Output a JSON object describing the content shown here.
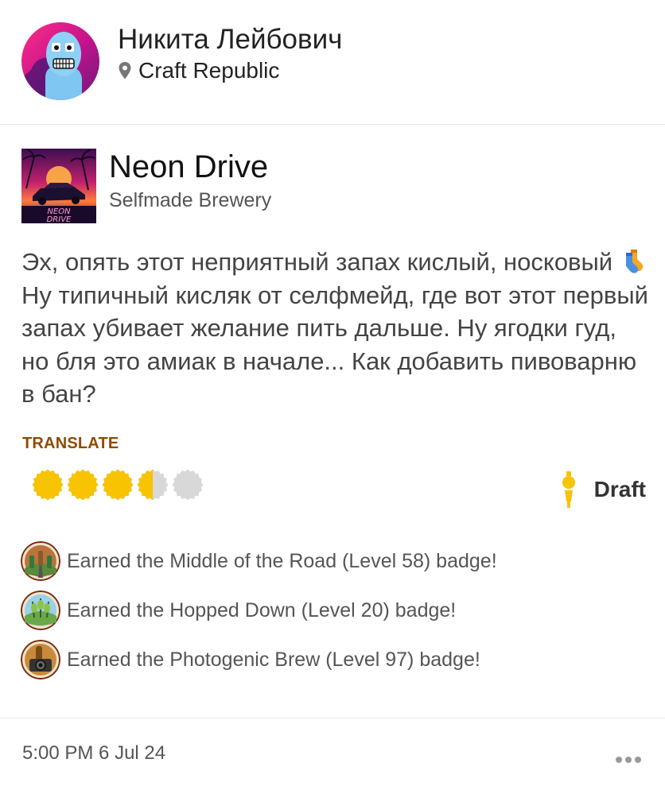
{
  "user": {
    "name": "Никита Лейбович",
    "location": "Craft Republic",
    "avatar_icon": "cartoon-face-avatar",
    "location_icon": "map-pin-icon"
  },
  "beer": {
    "name": "Neon Drive",
    "brewery": "Selfmade Brewery",
    "label_text_line1": "NEON",
    "label_text_line2": "DRIVE"
  },
  "checkin": {
    "comment_part1": "Эх, опять этот неприятный запах кислый, носковый",
    "comment_emoji": "socks-emoji",
    "comment_part2": "Ну типичный кисляк от селфмейд, где вот этот первый запах убивает желание пить дальше. Ну ягодки гуд, но бля это амиак в начале... Как добавить пивоварню в бан?",
    "translate_label": "TRANSLATE",
    "rating": {
      "value": 3.5,
      "max": 5
    },
    "serving": "Draft",
    "serving_icon": "draft-tap-icon"
  },
  "badges": [
    {
      "text": "Earned the Middle of the Road (Level 58) badge!",
      "icon": "middle-of-the-road-badge-icon"
    },
    {
      "text": "Earned the Hopped Down (Level 20) badge!",
      "icon": "hopped-down-badge-icon"
    },
    {
      "text": "Earned the Photogenic Brew (Level 97) badge!",
      "icon": "photogenic-brew-badge-icon"
    }
  ],
  "footer": {
    "timestamp": "5:00 PM 6 Jul 24",
    "more_icon": "more-options-icon"
  },
  "colors": {
    "rating_full": "#f8c300",
    "rating_empty": "#d8d8d8",
    "translate": "#8f4a00",
    "divider": "#e6e6e6"
  }
}
